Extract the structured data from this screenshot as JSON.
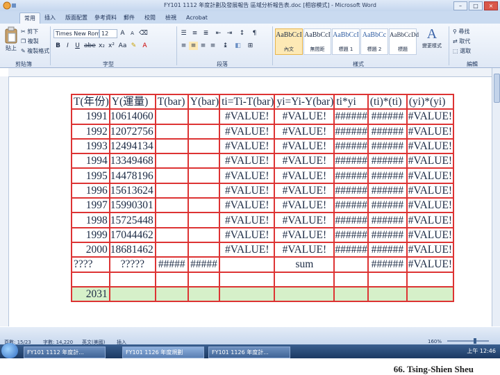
{
  "window": {
    "title": "FY101 1112 年度計劃及發展報告 區域分析報告表.doc [相容模式] - Microsoft Word"
  },
  "tabs": [
    "常用",
    "插入",
    "版面配置",
    "參考資料",
    "郵件",
    "校閱",
    "檢視",
    "Acrobat"
  ],
  "ribbon": {
    "clipboard": {
      "paste": "貼上",
      "cut": "剪下",
      "copy": "複製",
      "format_painter": "複製格式",
      "label": "剪貼簿"
    },
    "font": {
      "name": "Times New Roman",
      "size": "12",
      "label": "字型"
    },
    "paragraph": {
      "label": "段落"
    },
    "styles": {
      "items": [
        {
          "sample": "AaBbCcI",
          "name": "內文"
        },
        {
          "sample": "AaBbCcI",
          "name": "無間距"
        },
        {
          "sample": "AaBbCcI",
          "name": "標題 1"
        },
        {
          "sample": "AaBbCc",
          "name": "標題 2"
        },
        {
          "sample": "AaBbCcDd",
          "name": "標題"
        }
      ],
      "change_styles": "變更樣式",
      "label": "樣式"
    },
    "editing": {
      "find": "尋找",
      "replace": "取代",
      "select": "選取",
      "label": "編輯"
    }
  },
  "table": {
    "header": [
      "T(年份)",
      "Y(運量)",
      "T(bar)",
      "Y(bar)",
      "ti=Ti-T(bar)",
      "yi=Yi-Y(bar)",
      "ti*yi",
      "(ti)*(ti)",
      "(yi)*(yi)"
    ],
    "rows": [
      [
        "1991",
        "10614060",
        "",
        "",
        "#VALUE!",
        "#VALUE!",
        "######",
        "######",
        "#VALUE!"
      ],
      [
        "1992",
        "12072756",
        "",
        "",
        "#VALUE!",
        "#VALUE!",
        "######",
        "######",
        "#VALUE!"
      ],
      [
        "1993",
        "12494134",
        "",
        "",
        "#VALUE!",
        "#VALUE!",
        "######",
        "######",
        "#VALUE!"
      ],
      [
        "1994",
        "13349468",
        "",
        "",
        "#VALUE!",
        "#VALUE!",
        "######",
        "######",
        "#VALUE!"
      ],
      [
        "1995",
        "14478196",
        "",
        "",
        "#VALUE!",
        "#VALUE!",
        "######",
        "######",
        "#VALUE!"
      ],
      [
        "1996",
        "15613624",
        "",
        "",
        "#VALUE!",
        "#VALUE!",
        "######",
        "######",
        "#VALUE!"
      ],
      [
        "1997",
        "15990301",
        "",
        "",
        "#VALUE!",
        "#VALUE!",
        "######",
        "######",
        "#VALUE!"
      ],
      [
        "1998",
        "15725448",
        "",
        "",
        "#VALUE!",
        "#VALUE!",
        "######",
        "######",
        "#VALUE!"
      ],
      [
        "1999",
        "17044462",
        "",
        "",
        "#VALUE!",
        "#VALUE!",
        "######",
        "######",
        "#VALUE!"
      ],
      [
        "2000",
        "18681462",
        "",
        "",
        "#VALUE!",
        "#VALUE!",
        "######",
        "######",
        "#VALUE!"
      ],
      [
        "????",
        "?????",
        "#####",
        "#####",
        "",
        "sum",
        "",
        "######",
        "#VALUE!"
      ],
      [
        "",
        "",
        "",
        "",
        "",
        "",
        "",
        "",
        ""
      ],
      [
        "2031",
        "",
        "",
        "",
        "",
        "",
        "",
        "",
        ""
      ]
    ]
  },
  "status": {
    "page": "頁數: 15/23",
    "words": "字數: 14,220",
    "lang": "英文(美國)",
    "mode": "插入",
    "zoom": "160%"
  },
  "taskbar": {
    "items": [
      "FY101 1112 年度計...",
      "FY101 1126 年度規劃",
      "FY101 1126 年度計..."
    ],
    "clock": "上午 12:46"
  },
  "footer": {
    "caption": "66. Tsing-Shien Sheu"
  }
}
